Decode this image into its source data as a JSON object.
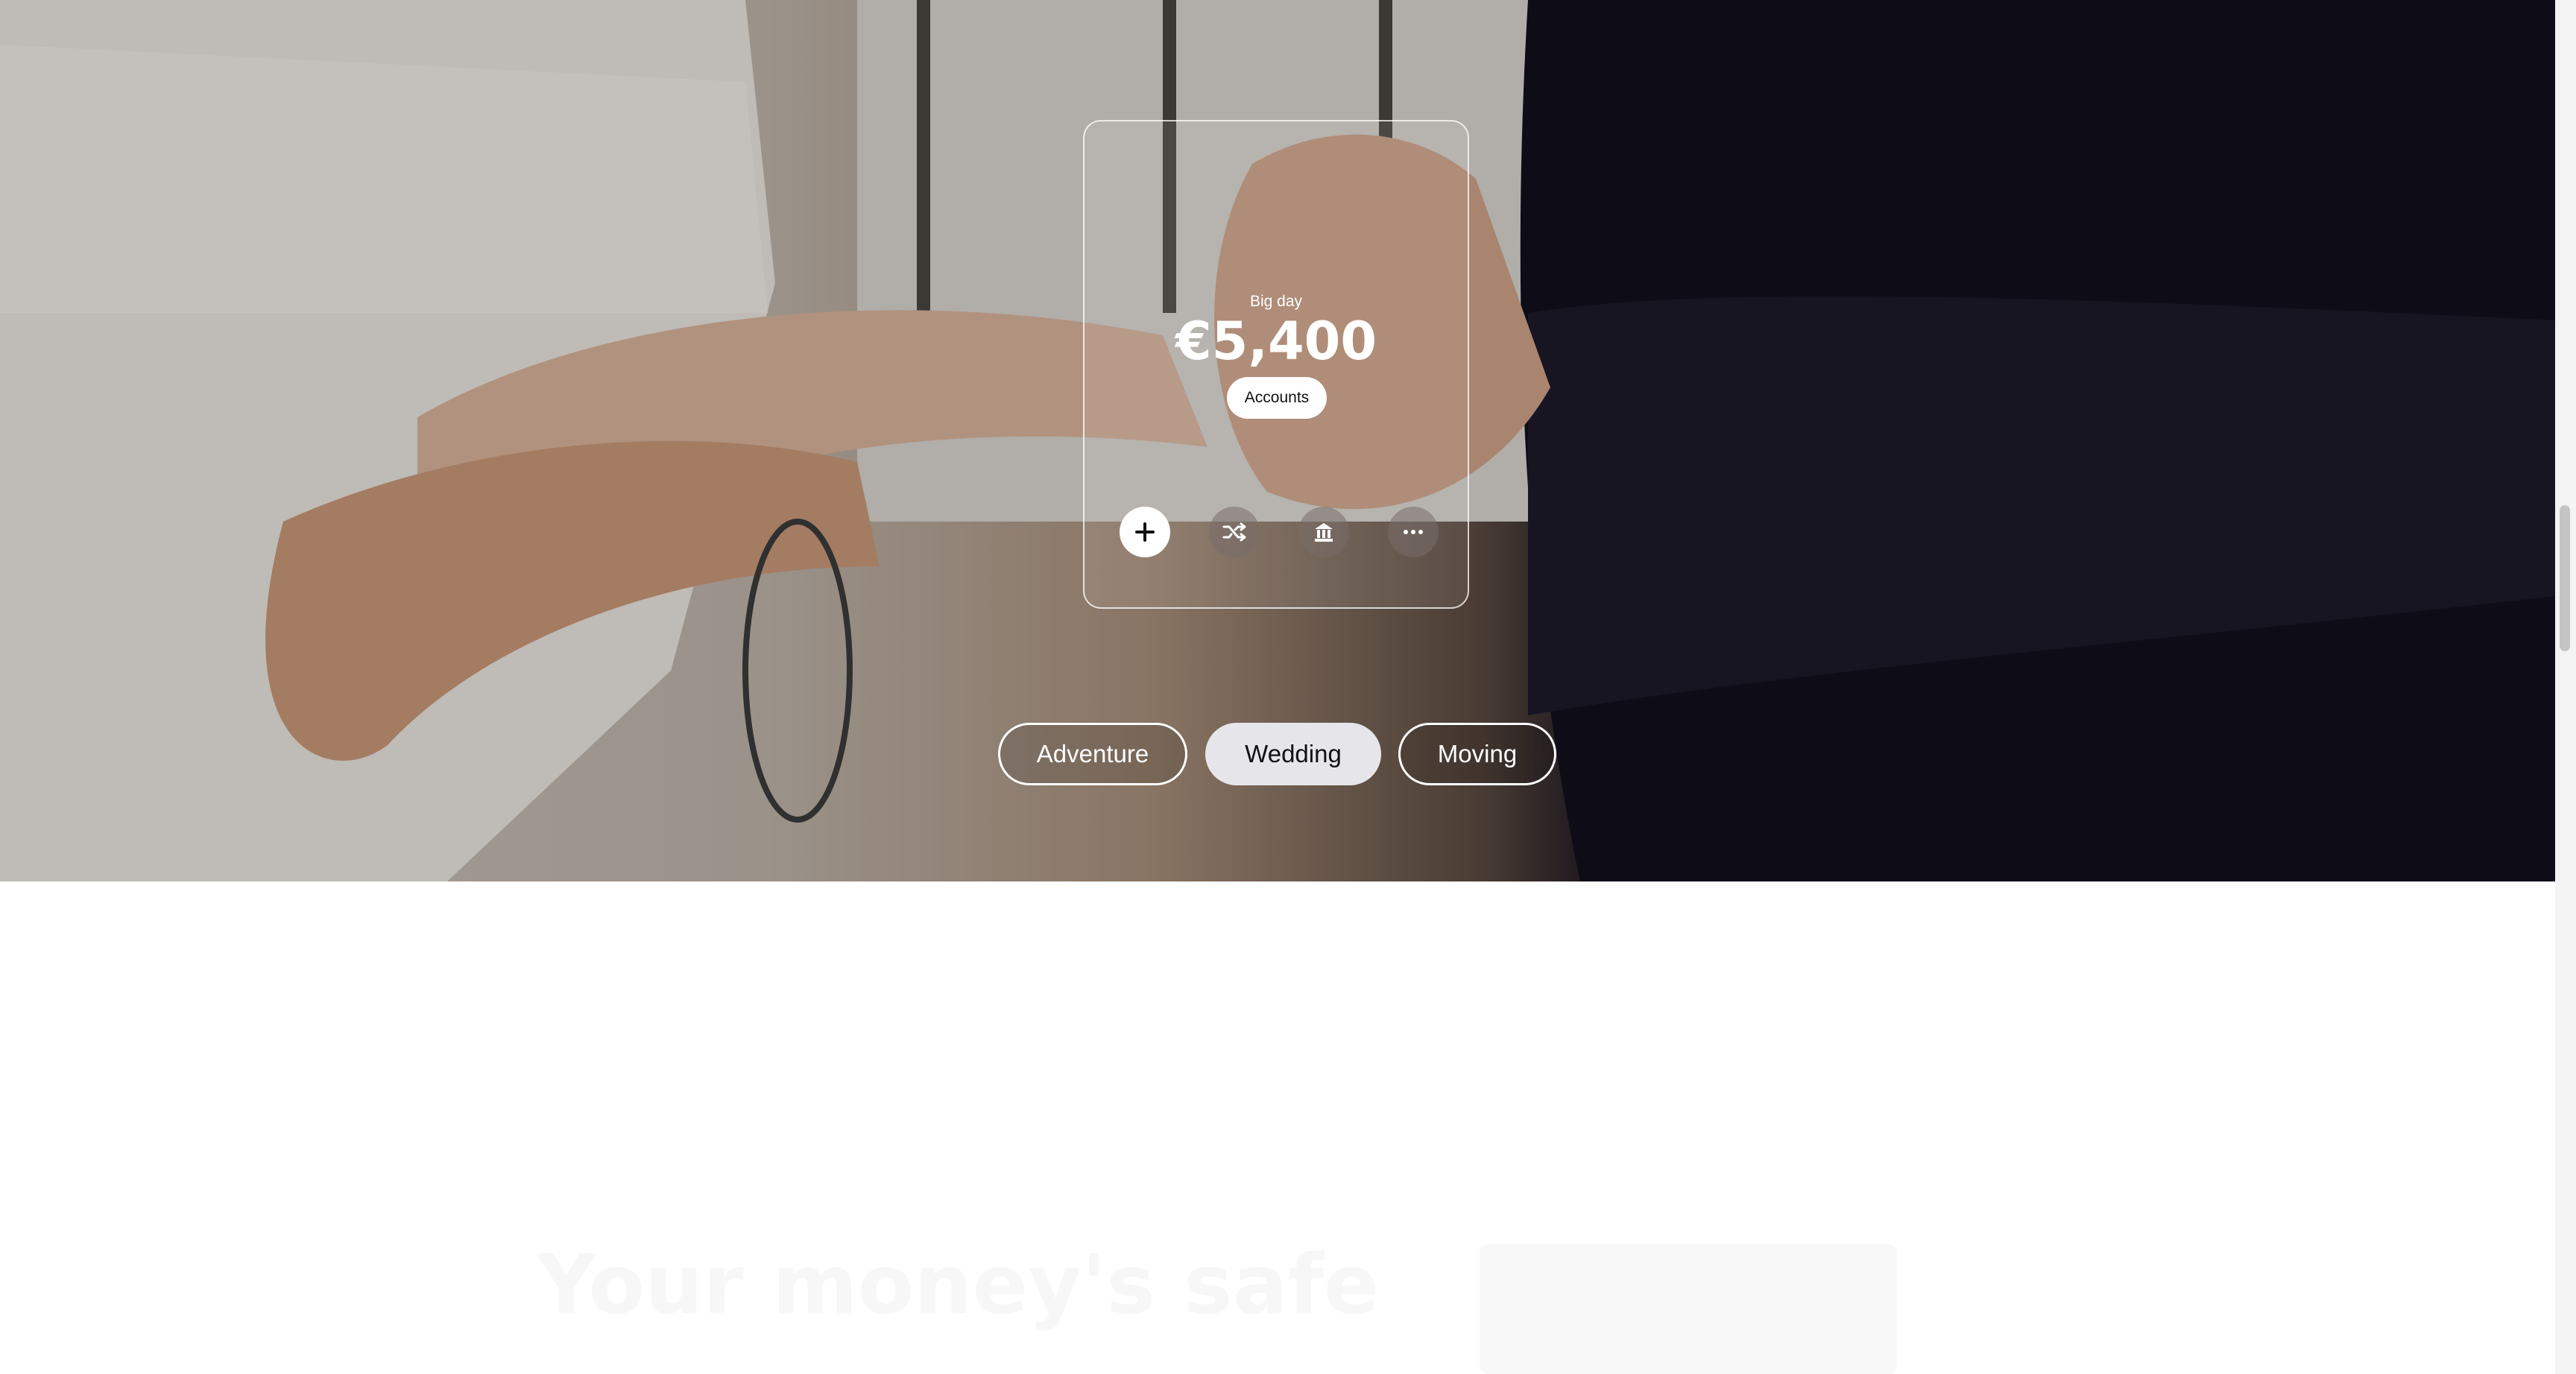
{
  "card": {
    "label": "Big day",
    "amount": "€5,400",
    "accounts_label": "Accounts"
  },
  "actions": [
    {
      "icon": "plus-icon"
    },
    {
      "icon": "shuffle-icon"
    },
    {
      "icon": "bank-icon"
    },
    {
      "icon": "more-icon"
    }
  ],
  "pills": [
    "Adventure",
    "Wedding",
    "Moving"
  ],
  "active_pill": "Wedding",
  "section": {
    "title": "Your money's safe"
  },
  "colors": {
    "pill_active_bg": "#e6e6ea",
    "card_border": "#ffffff",
    "page_bg": "#ffffff"
  }
}
